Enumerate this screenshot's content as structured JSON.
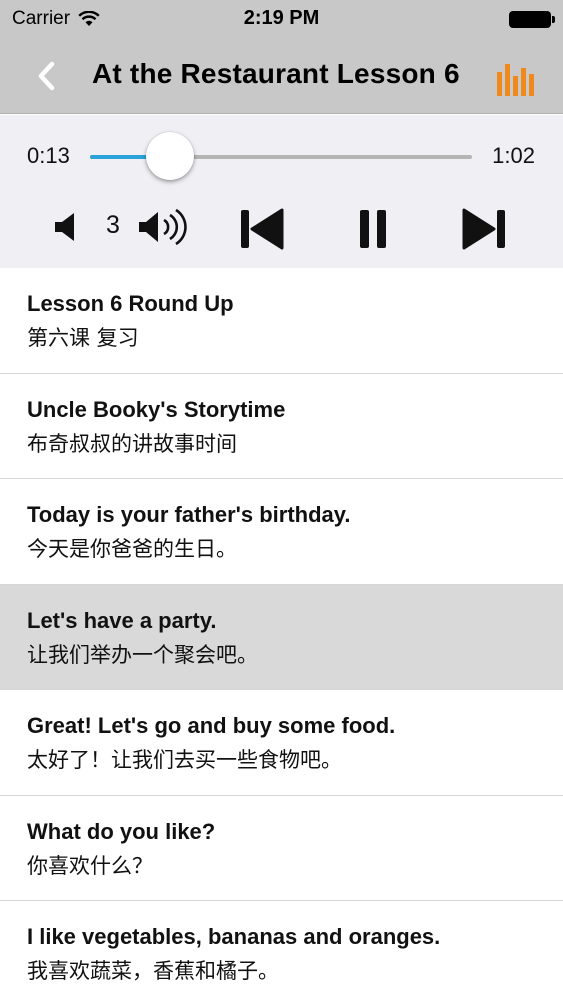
{
  "status_bar": {
    "carrier": "Carrier",
    "time": "2:19 PM"
  },
  "nav": {
    "title": "At the Restaurant Lesson 6",
    "accent_color": "#f0891c"
  },
  "player": {
    "elapsed": "0:13",
    "total": "1:02",
    "progress_fraction": 0.21,
    "volume": "3",
    "track_color": "#2ba3d9"
  },
  "lessons": [
    {
      "en": "Lesson 6 Round Up",
      "zh": "第六课 复习",
      "selected": false
    },
    {
      "en": "Uncle Booky's Storytime",
      "zh": "布奇叔叔的讲故事时间",
      "selected": false
    },
    {
      "en": "Today is your father's birthday.",
      "zh": "今天是你爸爸的生日。",
      "selected": false
    },
    {
      "en": "Let's have a party.",
      "zh": "让我们举办一个聚会吧。",
      "selected": true
    },
    {
      "en": "Great! Let's go and buy some food.",
      "zh": "太好了！让我们去买一些食物吧。",
      "selected": false
    },
    {
      "en": "What do you like?",
      "zh": "你喜欢什么？",
      "selected": false
    },
    {
      "en": "I like vegetables, bananas and oranges.",
      "zh": "我喜欢蔬菜，香蕉和橘子。",
      "selected": false
    }
  ]
}
